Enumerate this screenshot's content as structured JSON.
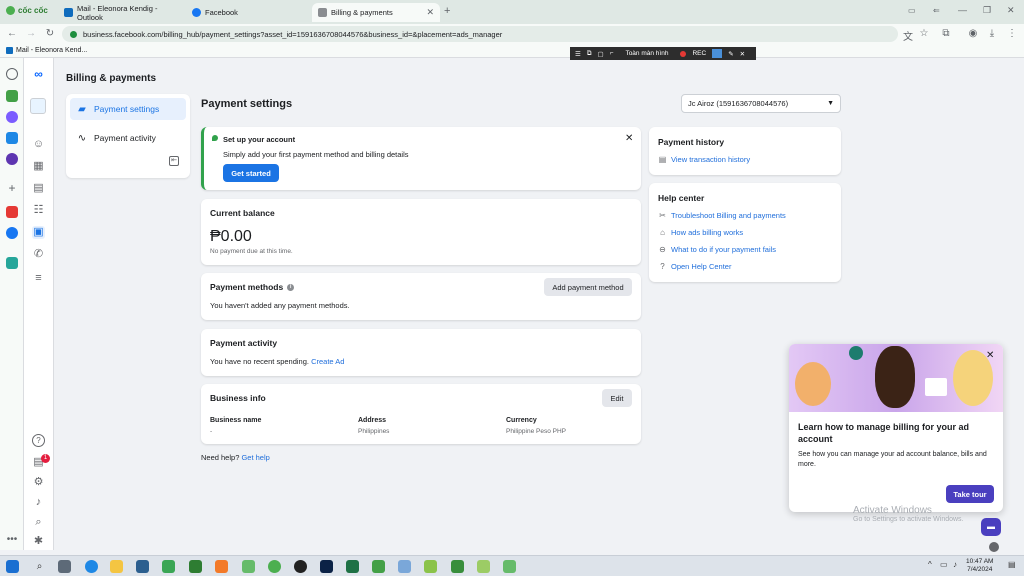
{
  "browser": {
    "logo": "cốc cốc",
    "tabs": [
      {
        "label": "Mail - Eleonora Kendig - Outlook",
        "color": "#0f6cbd"
      },
      {
        "label": "Facebook",
        "color": "#1877f2"
      },
      {
        "label": "Billing & payments",
        "color": "#5f6368"
      }
    ],
    "url": "business.facebook.com/billing_hub/payment_settings?asset_id=1591636708044576&business_id=&placement=ads_manager",
    "bookmark": "Mail - Eleonora Kend...",
    "recbar": {
      "screen_label": "Toàn màn hình",
      "rec_label": "REC"
    }
  },
  "page": {
    "title": "Billing & payments",
    "nav": [
      {
        "label": "Payment settings",
        "icon": "credit-card-icon"
      },
      {
        "label": "Payment activity",
        "icon": "activity-icon"
      }
    ],
    "heading": "Payment settings",
    "account_selector": "Jc Airoz (1591636708044576)"
  },
  "setup_card": {
    "title": "Set up your account",
    "desc": "Simply add your first payment method and billing details",
    "button": "Get started"
  },
  "balance_card": {
    "title": "Current balance",
    "amount": "₱0.00",
    "note": "No payment due at this time."
  },
  "methods_card": {
    "title": "Payment methods",
    "text": "You haven't added any payment methods.",
    "button": "Add payment method"
  },
  "activity_card": {
    "title": "Payment activity",
    "text": "You have no recent spending.",
    "link": "Create Ad"
  },
  "business_card": {
    "title": "Business info",
    "edit": "Edit",
    "columns": [
      {
        "label": "Business name",
        "value": "-"
      },
      {
        "label": "Address",
        "value": "Philippines"
      },
      {
        "label": "Currency",
        "value": "Philippine Peso PHP"
      }
    ]
  },
  "help_footer": {
    "text": "Need help?",
    "link": "Get help"
  },
  "history_card": {
    "title": "Payment history",
    "link": "View transaction history"
  },
  "help_center": {
    "title": "Help center",
    "links": [
      "Troubleshoot Billing and payments",
      "How ads billing works",
      "What to do if your payment fails",
      "Open Help Center"
    ]
  },
  "tour_popup": {
    "title": "Learn how to manage billing for your ad account",
    "desc": "See how you can manage your ad account balance, bills and more.",
    "button": "Take tour"
  },
  "watermark": {
    "line1": "Activate Windows",
    "line2": "Go to Settings to activate Windows."
  },
  "rail_badge": "1",
  "taskbar": {
    "time": "10:47 AM",
    "date": "7/4/2024"
  }
}
